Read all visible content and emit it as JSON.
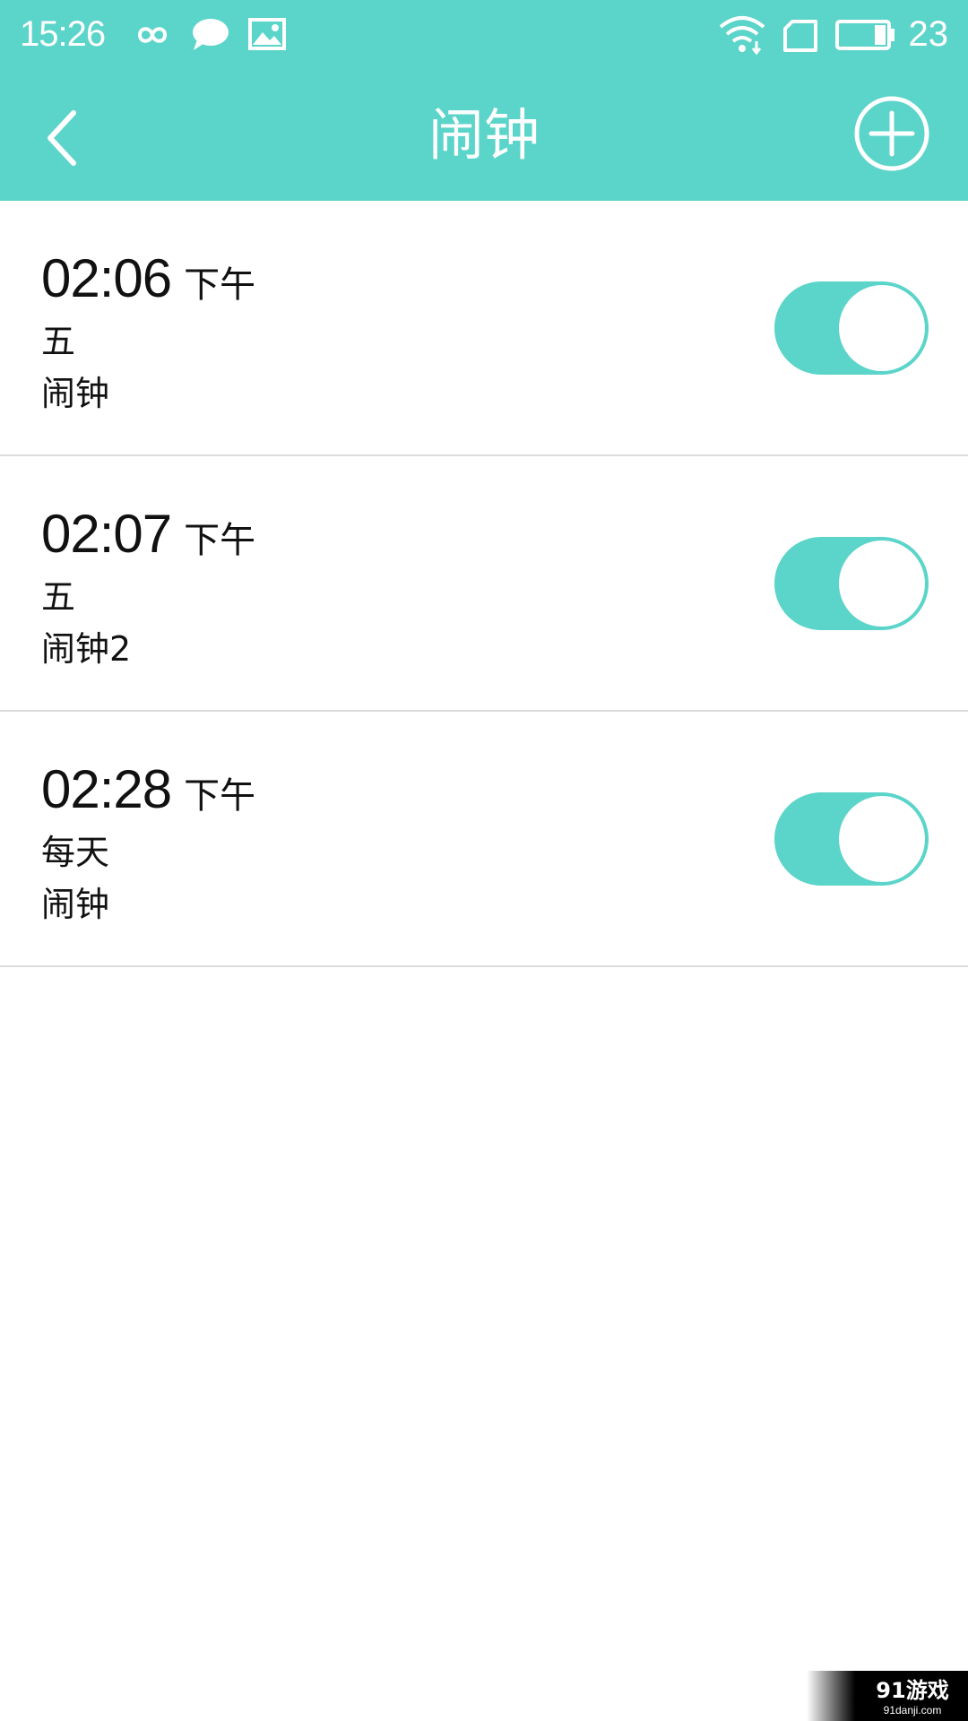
{
  "status_bar": {
    "time": "15:26",
    "battery_level": "23",
    "icons": [
      "infinity-icon",
      "chat-bubble-icon",
      "image-icon",
      "wifi-icon",
      "sim-card-icon",
      "battery-icon"
    ]
  },
  "app_bar": {
    "title": "闹钟",
    "back_icon": "chevron-left-icon",
    "add_icon": "plus-circle-icon"
  },
  "alarms": [
    {
      "time": "02:06",
      "ampm": "下午",
      "repeat": "五",
      "label": "闹钟",
      "enabled": true
    },
    {
      "time": "02:07",
      "ampm": "下午",
      "repeat": "五",
      "label": "闹钟2",
      "enabled": true
    },
    {
      "time": "02:28",
      "ampm": "下午",
      "repeat": "每天",
      "label": "闹钟",
      "enabled": true
    }
  ],
  "colors": {
    "accent": "#5bd4c9",
    "background": "#ffffff",
    "divider": "#dcdcdc",
    "text": "#111111"
  },
  "watermark": {
    "logo_text": "91游戏",
    "url_text": "91danji.com"
  }
}
